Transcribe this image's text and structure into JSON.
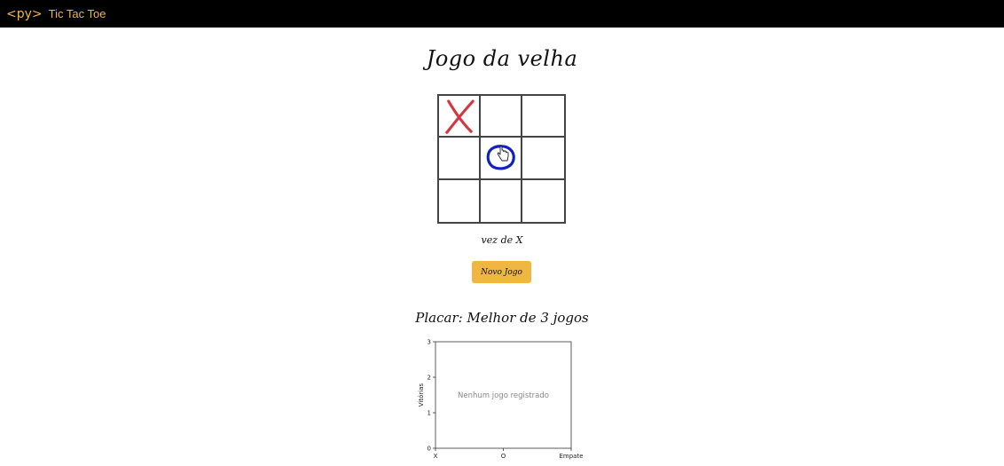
{
  "app": {
    "logo": "<py>",
    "title": "Tic Tac Toe"
  },
  "page_title": "Jogo da velha",
  "board": {
    "cells": [
      "X",
      "",
      "",
      "",
      "O",
      "",
      "",
      "",
      ""
    ]
  },
  "colors": {
    "x_mark": "#d4373f",
    "o_mark": "#1020c0",
    "button": "#f0b642"
  },
  "turn_text": "vez de X",
  "new_game_label": "Novo Jogo",
  "score_title": "Placar: Melhor de 3 jogos",
  "chart_data": {
    "type": "bar",
    "categories": [
      "X",
      "O",
      "Empate"
    ],
    "values": [
      0,
      0,
      0
    ],
    "ylabel": "Vitórias",
    "xlabel": "",
    "ylim": [
      0,
      3
    ],
    "yticks": [
      0,
      1,
      2,
      3
    ],
    "empty_message": "Nenhum jogo registrado"
  }
}
